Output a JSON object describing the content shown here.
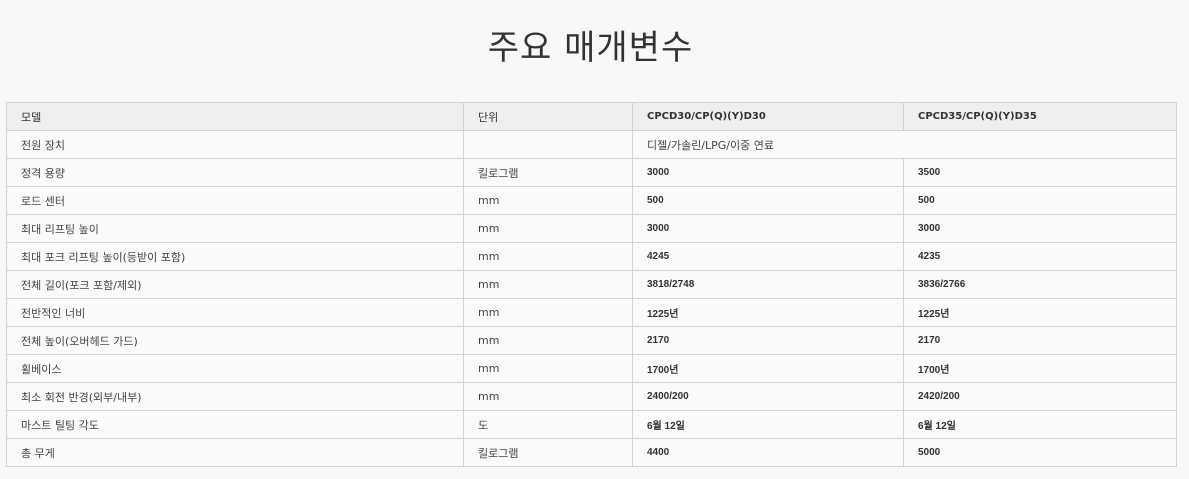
{
  "title": "주요 매개변수",
  "table": {
    "headers": [
      "모델",
      "단위",
      "CPCD30/CP(Q)(Y)D30",
      "CPCD35/CP(Q)(Y)D35"
    ],
    "power_row": {
      "name": "전원 장치",
      "unit": "",
      "value": "디젤/가솔린/LPG/이중 연료"
    },
    "rows": [
      {
        "name": "정격 용량",
        "unit": "킬로그램",
        "v1": "3000",
        "v2": "3500"
      },
      {
        "name": "로드 센터",
        "unit": "mm",
        "v1": "500",
        "v2": "500"
      },
      {
        "name": "최대 리프팅 높이",
        "unit": "mm",
        "v1": "3000",
        "v2": "3000"
      },
      {
        "name": "최대 포크 리프팅 높이(등받이 포함)",
        "unit": "mm",
        "v1": "4245",
        "v2": "4235"
      },
      {
        "name": "전체 길이(포크 포함/제외)",
        "unit": "mm",
        "v1": "3818/2748",
        "v2": "3836/2766"
      },
      {
        "name": "전반적인 너비",
        "unit": "mm",
        "v1": "1225년",
        "v2": "1225년"
      },
      {
        "name": "전체 높이(오버헤드 가드)",
        "unit": "mm",
        "v1": "2170",
        "v2": "2170"
      },
      {
        "name": "휠베이스",
        "unit": "mm",
        "v1": "1700년",
        "v2": "1700년"
      },
      {
        "name": "최소 회전 반경(외부/내부)",
        "unit": "mm",
        "v1": "2400/200",
        "v2": "2420/200"
      },
      {
        "name": "마스트 틸팅 각도",
        "unit": "도",
        "v1": "6월 12일",
        "v2": "6월 12일"
      },
      {
        "name": "총 무게",
        "unit": "킬로그램",
        "v1": "4400",
        "v2": "5000"
      }
    ]
  }
}
